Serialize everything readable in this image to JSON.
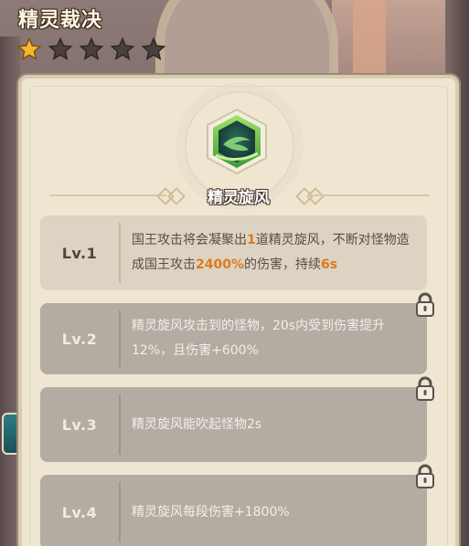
{
  "header": {
    "title": "精灵裁决",
    "stars_total": 5,
    "stars_filled": 1
  },
  "skill": {
    "name": "精灵旋风",
    "icon": "green-whirlwind-crystal-icon"
  },
  "levels": [
    {
      "label": "Lv.1",
      "locked": false,
      "text_1": "国王攻击将会凝聚出",
      "hl_1": "1",
      "text_2": "道精灵旋风，不断对怪物造成国王攻击",
      "hl_2": "2400%",
      "text_3": "的伤害，持续",
      "hl_3": "6s"
    },
    {
      "label": "Lv.2",
      "locked": true,
      "text": "精灵旋风攻击到的怪物，20s内受到伤害提升12%，且伤害+600%"
    },
    {
      "label": "Lv.3",
      "locked": true,
      "text": "精灵旋风能吹起怪物2s"
    },
    {
      "label": "Lv.4",
      "locked": true,
      "text": "精灵旋风每段伤害+1800%"
    }
  ],
  "colors": {
    "highlight": "#e0791c",
    "star_filled": "#f5b82e",
    "star_empty": "#4a3f3a",
    "panel_bg": "#efe6d2"
  }
}
